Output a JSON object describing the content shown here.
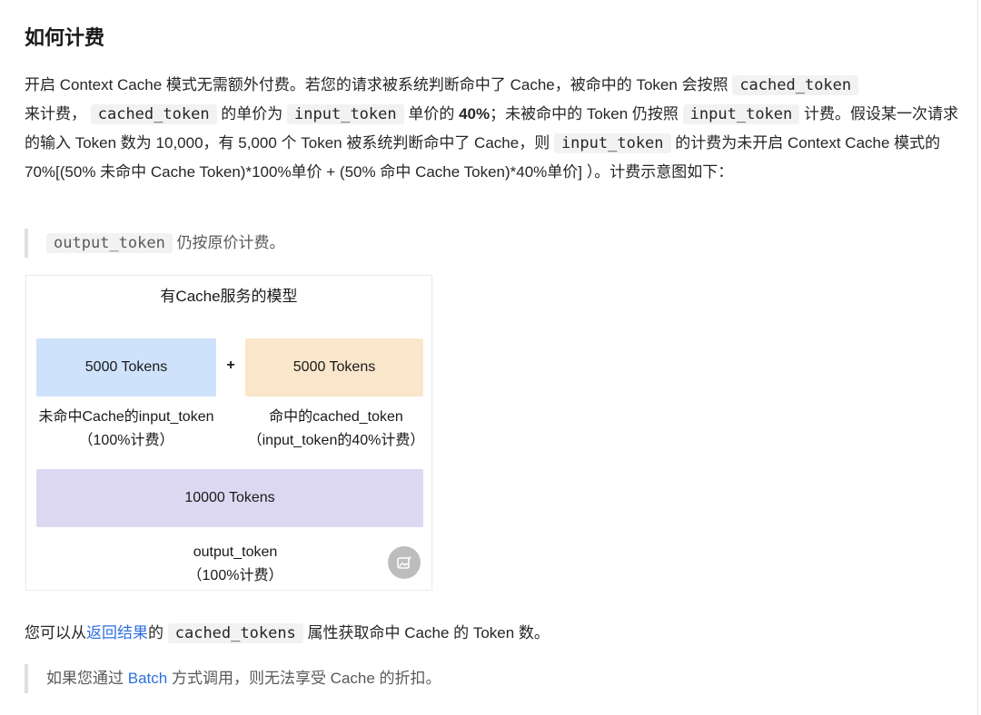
{
  "section": {
    "title": "如何计费"
  },
  "billing_paragraph": {
    "t1": "开启 Context Cache 模式无需额外付费。若您的请求被系统判断命中了 Cache，被命中的 Token 会按照",
    "c1": "cached_token",
    "t2": "来计费，",
    "c2": "cached_token",
    "t3": "的单价为",
    "c3": "input_token",
    "t4": "单价的",
    "bold": "40%",
    "t5": "；未被命中的 Token 仍按照",
    "c4": "input_token",
    "t6": "计费。假设某一次请求的输入 Token 数为 10,000，有 5,000 个 Token 被系统判断命中了 Cache，则",
    "c5": "input_token",
    "t7": "的计费为未开启 Context Cache 模式的 70%[(50% 未命中 Cache Token)*100%单价 + (50% 命中 Cache Token)*40%单价] ）。计费示意图如下："
  },
  "quote_output": {
    "code": "output_token",
    "text": "仍按原价计费。"
  },
  "diagram": {
    "title": "有Cache服务的模型",
    "box_uncached": "5000 Tokens",
    "plus": "+",
    "box_cached": "5000 Tokens",
    "caption_uncached_line1": "未命中Cache的input_token",
    "caption_uncached_line2": "（100%计费）",
    "caption_cached_line1": "命中的cached_token",
    "caption_cached_line2": "（input_token的40%计费）",
    "box_output": "10000 Tokens",
    "caption_output_line1": "output_token",
    "caption_output_line2": "（100%计费）",
    "fab_icon": "image-sparkle-icon",
    "colors": {
      "uncached": "#cfe2fb",
      "cached": "#fae6cb",
      "output": "#ddd8f2"
    }
  },
  "note": {
    "t1": "您可以从",
    "link": "返回结果",
    "t2": "的",
    "code": "cached_tokens",
    "t3": "属性获取命中 Cache 的 Token 数。"
  },
  "quote_batch": {
    "t1": "如果您通过",
    "link": "Batch",
    "t2": "方式调用，则无法享受 Cache 的折扣。"
  },
  "colors": {
    "link": "#2f6fe0",
    "text": "#262626",
    "quote_border": "#e0e0e0"
  }
}
